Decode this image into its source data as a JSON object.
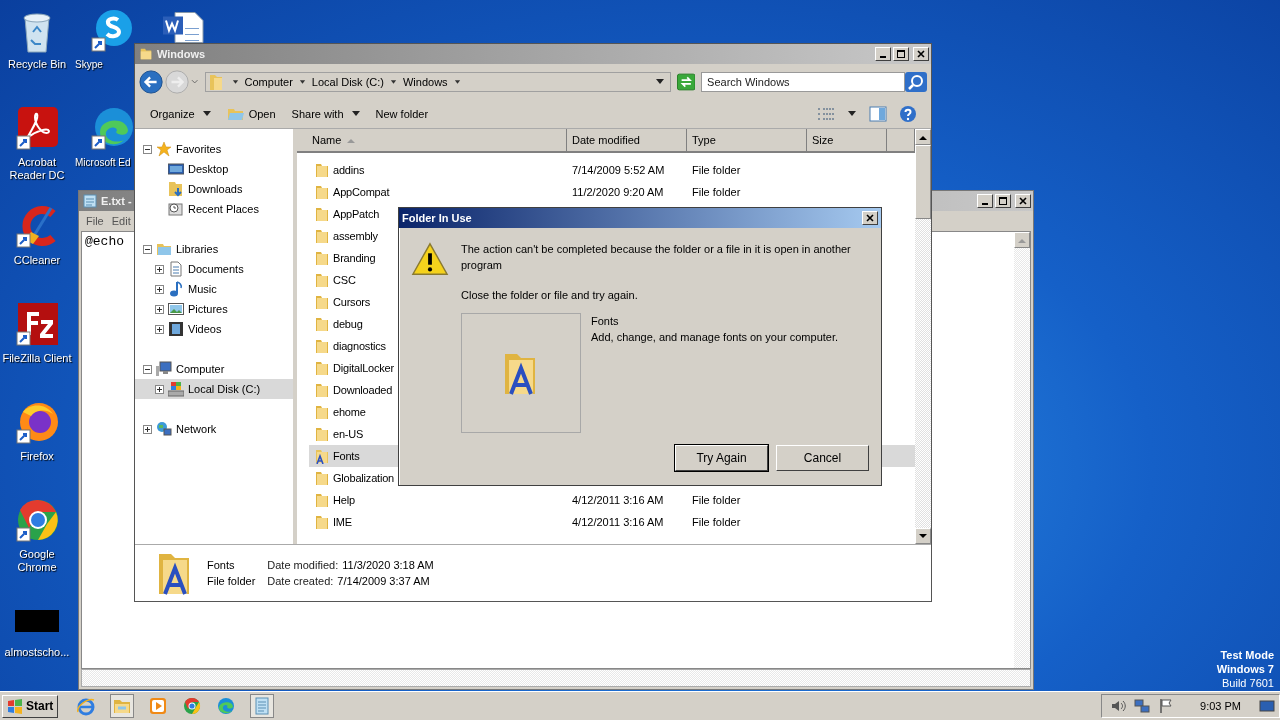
{
  "desktop": {
    "icons": [
      {
        "label": "Recycle Bin",
        "kind": "recycle"
      },
      {
        "label": "Skype",
        "kind": "skype"
      },
      {
        "kind": "word"
      },
      {
        "label": "Acrobat Reader DC",
        "kind": "acrobat"
      },
      {
        "label": "Microsoft Ed",
        "kind": "edge"
      },
      {
        "label": "CCleaner",
        "kind": "ccleaner"
      },
      {
        "label": "FileZilla Client",
        "kind": "filezilla"
      },
      {
        "label": "Firefox",
        "kind": "firefox"
      },
      {
        "label": "Google Chrome",
        "kind": "chrome"
      },
      {
        "label": "almostscho...",
        "kind": "blank"
      }
    ],
    "os_info": [
      "Test Mode",
      "Windows 7",
      "Build 7601"
    ]
  },
  "notepad": {
    "title": "E.txt -",
    "menu": [
      "File",
      "Edit"
    ],
    "text": "@echo"
  },
  "explorer": {
    "title": "Windows",
    "breadcrumb": [
      "Computer",
      "Local Disk (C:)",
      "Windows"
    ],
    "search": {
      "placeholder": "Search Windows"
    },
    "toolbar": [
      {
        "label": "Organize",
        "kind": "menu"
      },
      {
        "label": "Open",
        "kind": "open"
      },
      {
        "label": "Share with",
        "kind": "menu"
      },
      {
        "label": "New folder",
        "kind": "plain"
      }
    ],
    "nav": [
      {
        "label": "Favorites",
        "kind": "star",
        "expanded": true,
        "selected": false,
        "children": [
          {
            "label": "Desktop",
            "kind": "desktop",
            "selected": false
          },
          {
            "label": "Downloads",
            "kind": "downloads",
            "selected": false
          },
          {
            "label": "Recent Places",
            "kind": "recent",
            "selected": false
          }
        ]
      },
      {
        "label": "Libraries",
        "kind": "library",
        "expanded": true,
        "selected": false,
        "children": [
          {
            "label": "Documents",
            "kind": "documents",
            "expanded": false,
            "selected": false
          },
          {
            "label": "Music",
            "kind": "music",
            "expanded": false,
            "selected": false
          },
          {
            "label": "Pictures",
            "kind": "pictures",
            "expanded": false,
            "selected": false
          },
          {
            "label": "Videos",
            "kind": "videos",
            "expanded": false,
            "selected": false
          }
        ]
      },
      {
        "label": "Computer",
        "kind": "computer",
        "expanded": true,
        "selected": false,
        "children": [
          {
            "label": "Local Disk (C:)",
            "kind": "disk",
            "expanded": false,
            "selected": true
          }
        ]
      },
      {
        "label": "Network",
        "kind": "network",
        "expanded": false,
        "selected": false
      }
    ],
    "columns": [
      "Name",
      "Date modified",
      "Type",
      "Size"
    ],
    "rows": [
      {
        "name": "addins",
        "date": "7/14/2009 5:52 AM",
        "type": "File folder",
        "kind": "folder",
        "selected": false
      },
      {
        "name": "AppCompat",
        "date": "11/2/2020 9:20 AM",
        "type": "File folder",
        "kind": "folder",
        "selected": false
      },
      {
        "name": "AppPatch",
        "kind": "folder",
        "selected": false
      },
      {
        "name": "assembly",
        "kind": "folder",
        "selected": false
      },
      {
        "name": "Branding",
        "kind": "folder",
        "selected": false
      },
      {
        "name": "CSC",
        "kind": "folder",
        "selected": false
      },
      {
        "name": "Cursors",
        "kind": "folder",
        "selected": false
      },
      {
        "name": "debug",
        "kind": "folder",
        "selected": false
      },
      {
        "name": "diagnostics",
        "kind": "folder",
        "selected": false
      },
      {
        "name": "DigitalLocker",
        "kind": "folder",
        "selected": false
      },
      {
        "name": "Downloaded",
        "kind": "folder",
        "selected": false
      },
      {
        "name": "ehome",
        "kind": "folder",
        "selected": false
      },
      {
        "name": "en-US",
        "kind": "folder",
        "selected": false
      },
      {
        "name": "Fonts",
        "kind": "fonts",
        "selected": true
      },
      {
        "name": "Globalization",
        "kind": "folder",
        "selected": false
      },
      {
        "name": "Help",
        "date": "4/12/2011 3:16 AM",
        "type": "File folder",
        "kind": "folder",
        "selected": false
      },
      {
        "name": "IME",
        "date": "4/12/2011 3:16 AM",
        "type": "File folder",
        "kind": "folder",
        "selected": false
      }
    ],
    "details": {
      "name": "Fonts",
      "type": "File folder",
      "fields": [
        {
          "label": "Date modified:",
          "value": "11/3/2020 3:18 AM"
        },
        {
          "label": "Date created:",
          "value": "7/14/2009 3:37 AM"
        }
      ]
    }
  },
  "dialog": {
    "title": "Folder In Use",
    "message": "The action can't be completed because the folder or a file in it is open in another program",
    "hint": "Close the folder or file and try again.",
    "item": {
      "name": "Fonts",
      "description": "Add, change, and manage fonts on your computer."
    },
    "buttons": [
      {
        "label": "Try Again",
        "default": true
      },
      {
        "label": "Cancel",
        "default": false
      }
    ]
  },
  "taskbar": {
    "start": "Start",
    "apps": [
      {
        "kind": "ie"
      },
      {
        "kind": "explorer"
      },
      {
        "kind": "media"
      },
      {
        "kind": "chrome"
      },
      {
        "kind": "edge"
      },
      {
        "kind": "notepad"
      }
    ],
    "clock": "9:03 PM"
  }
}
